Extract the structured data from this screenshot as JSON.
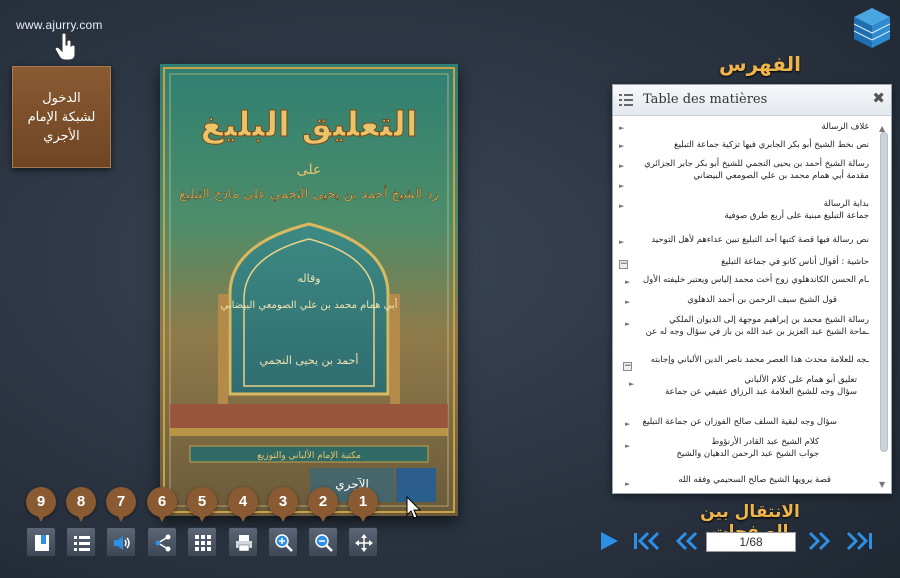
{
  "site": {
    "url": "www.ajurry.com"
  },
  "login": {
    "lines": [
      "الدخول",
      "لشبكة الإمام",
      "الأجري"
    ]
  },
  "book": {
    "title": "التعليق البليغ",
    "subtitle_a": "على",
    "subtitle_b": "رد الشيخ أحمد بن يحيى النجمي على مادح التبليغ",
    "author_line_1": "وقاله",
    "author_line_2": "أبي همام محمد بن علي الصومعي البيضاني",
    "author_line_3": "أحمد بن يحيى النجمي",
    "publisher_line": "مكتبة الإمام الألباني والتوزيع",
    "publisher_name": "الآجري",
    "colors": {
      "cover_green": "#3c7a6c",
      "cover_gold": "#c8a04a",
      "title_gold": "#e9c46a"
    }
  },
  "toc": {
    "heading": "الفهرس",
    "title": "Table des matières",
    "close_label": "✖",
    "items": [
      {
        "lines": [
          "غلاف الرسالة"
        ]
      },
      {
        "lines": [
          "نص بخط الشيخ أبو بكر الجابري  فيها تزكية جماعة التبليغ"
        ]
      },
      {
        "lines": [
          "رسالة الشيخ أحمد بن يحيى النجمي للشيخ أبو بكر جابر الجزائري",
          "مقدمة أبي همام محمد بن علي الصومعي البيضاني"
        ]
      },
      {
        "lines": [
          "بداية  الرسالة",
          "جماعة التبليغ مبنية على أربع طرق صوفية"
        ]
      },
      {
        "lines": [
          "نص رسالة فيها قصة كتبها أحد التبليغ تبين عداءهم لأهل التوحيد"
        ]
      },
      {
        "lines": [
          "حاشية : أقوال أناس كانو في جماعة التبليغ"
        ]
      },
      {
        "lines": [
          "ـام الحسن الكاندهلوي زوج أخت محمد إلياس ويعتبر خليفته الأول"
        ]
      },
      {
        "lines": [
          "قول الشيخ سيف الرحمن بن أحمد الدهلوي"
        ]
      },
      {
        "lines": [
          "رسالة الشيخ محمد بن إبراهيم موجهة إلى الديوان الملكي",
          "ـماحة الشيخ عبد العزيز بن عبد الله بن باز في سؤال وجه له عن"
        ]
      },
      {
        "lines": [
          "ـجه للعلامة  محدث هذا العصر محمد ناصر الدين الألباني وإجابته"
        ]
      },
      {
        "lines": [
          "تعليق أبو همام على كلام الألباني",
          "سؤال وجه للشيخ العلامة عبد الرزاق عفيفي عن جماعة"
        ]
      },
      {
        "lines": [
          "سؤال وجه لبقية السلف صالح الفوزان عن جماعة التبليغ"
        ]
      },
      {
        "lines": [
          "كلام الشيخ عبد القادر الأرنؤوط",
          "جواب الشيخ عبد الرحمن الدهيان والشيخ"
        ]
      },
      {
        "lines": [
          "قصة يرويها الشيخ  صالح السحيمي وفقه الله"
        ]
      }
    ]
  },
  "navigation": {
    "heading": "الانتقال بين الصفحات",
    "page_indicator": "1/68",
    "buttons": [
      "play-icon",
      "first-page-icon",
      "previous-page-icon",
      "next-page-icon",
      "last-page-icon"
    ]
  },
  "toolbar": {
    "tools": [
      {
        "number": "9",
        "icon": "bookmark-icon"
      },
      {
        "number": "8",
        "icon": "table-of-contents-icon"
      },
      {
        "number": "7",
        "icon": "sound-icon"
      },
      {
        "number": "6",
        "icon": "share-icon"
      },
      {
        "number": "5",
        "icon": "thumbnails-icon"
      },
      {
        "number": "4",
        "icon": "print-icon"
      },
      {
        "number": "3",
        "icon": "zoom-in-icon"
      },
      {
        "number": "2",
        "icon": "zoom-out-icon"
      },
      {
        "number": "1",
        "icon": "move-icon"
      }
    ]
  }
}
